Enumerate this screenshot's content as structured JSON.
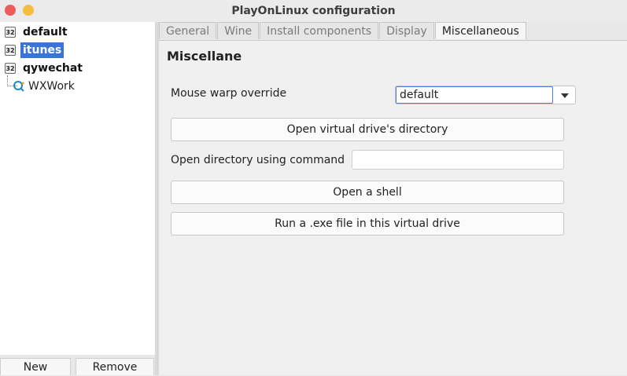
{
  "window": {
    "title": "PlayOnLinux configuration"
  },
  "tree": {
    "items": [
      {
        "label": "default",
        "badge": "32"
      },
      {
        "label": "itunes",
        "badge": "32",
        "selected": true
      },
      {
        "label": "qywechat",
        "badge": "32"
      }
    ],
    "child": {
      "label": "WXWork",
      "icon": "app-icon"
    }
  },
  "buttons": {
    "new": "New",
    "remove": "Remove"
  },
  "tabs": [
    "General",
    "Wine",
    "Install components",
    "Display",
    "Miscellaneous"
  ],
  "misc": {
    "heading": "Miscellaneous",
    "mouse_warp_label": "Mouse warp override",
    "mouse_warp_value": "default",
    "open_dir_button": "Open virtual drive's directory",
    "open_cmd_label": "Open directory using command",
    "open_cmd_value": "",
    "shell_button": "Open a shell",
    "run_exe_button": "Run a .exe file in this virtual drive"
  },
  "colors": {
    "selection": "#3a74d6",
    "close": "#ec5c5b",
    "minimize": "#f5bd3f"
  }
}
